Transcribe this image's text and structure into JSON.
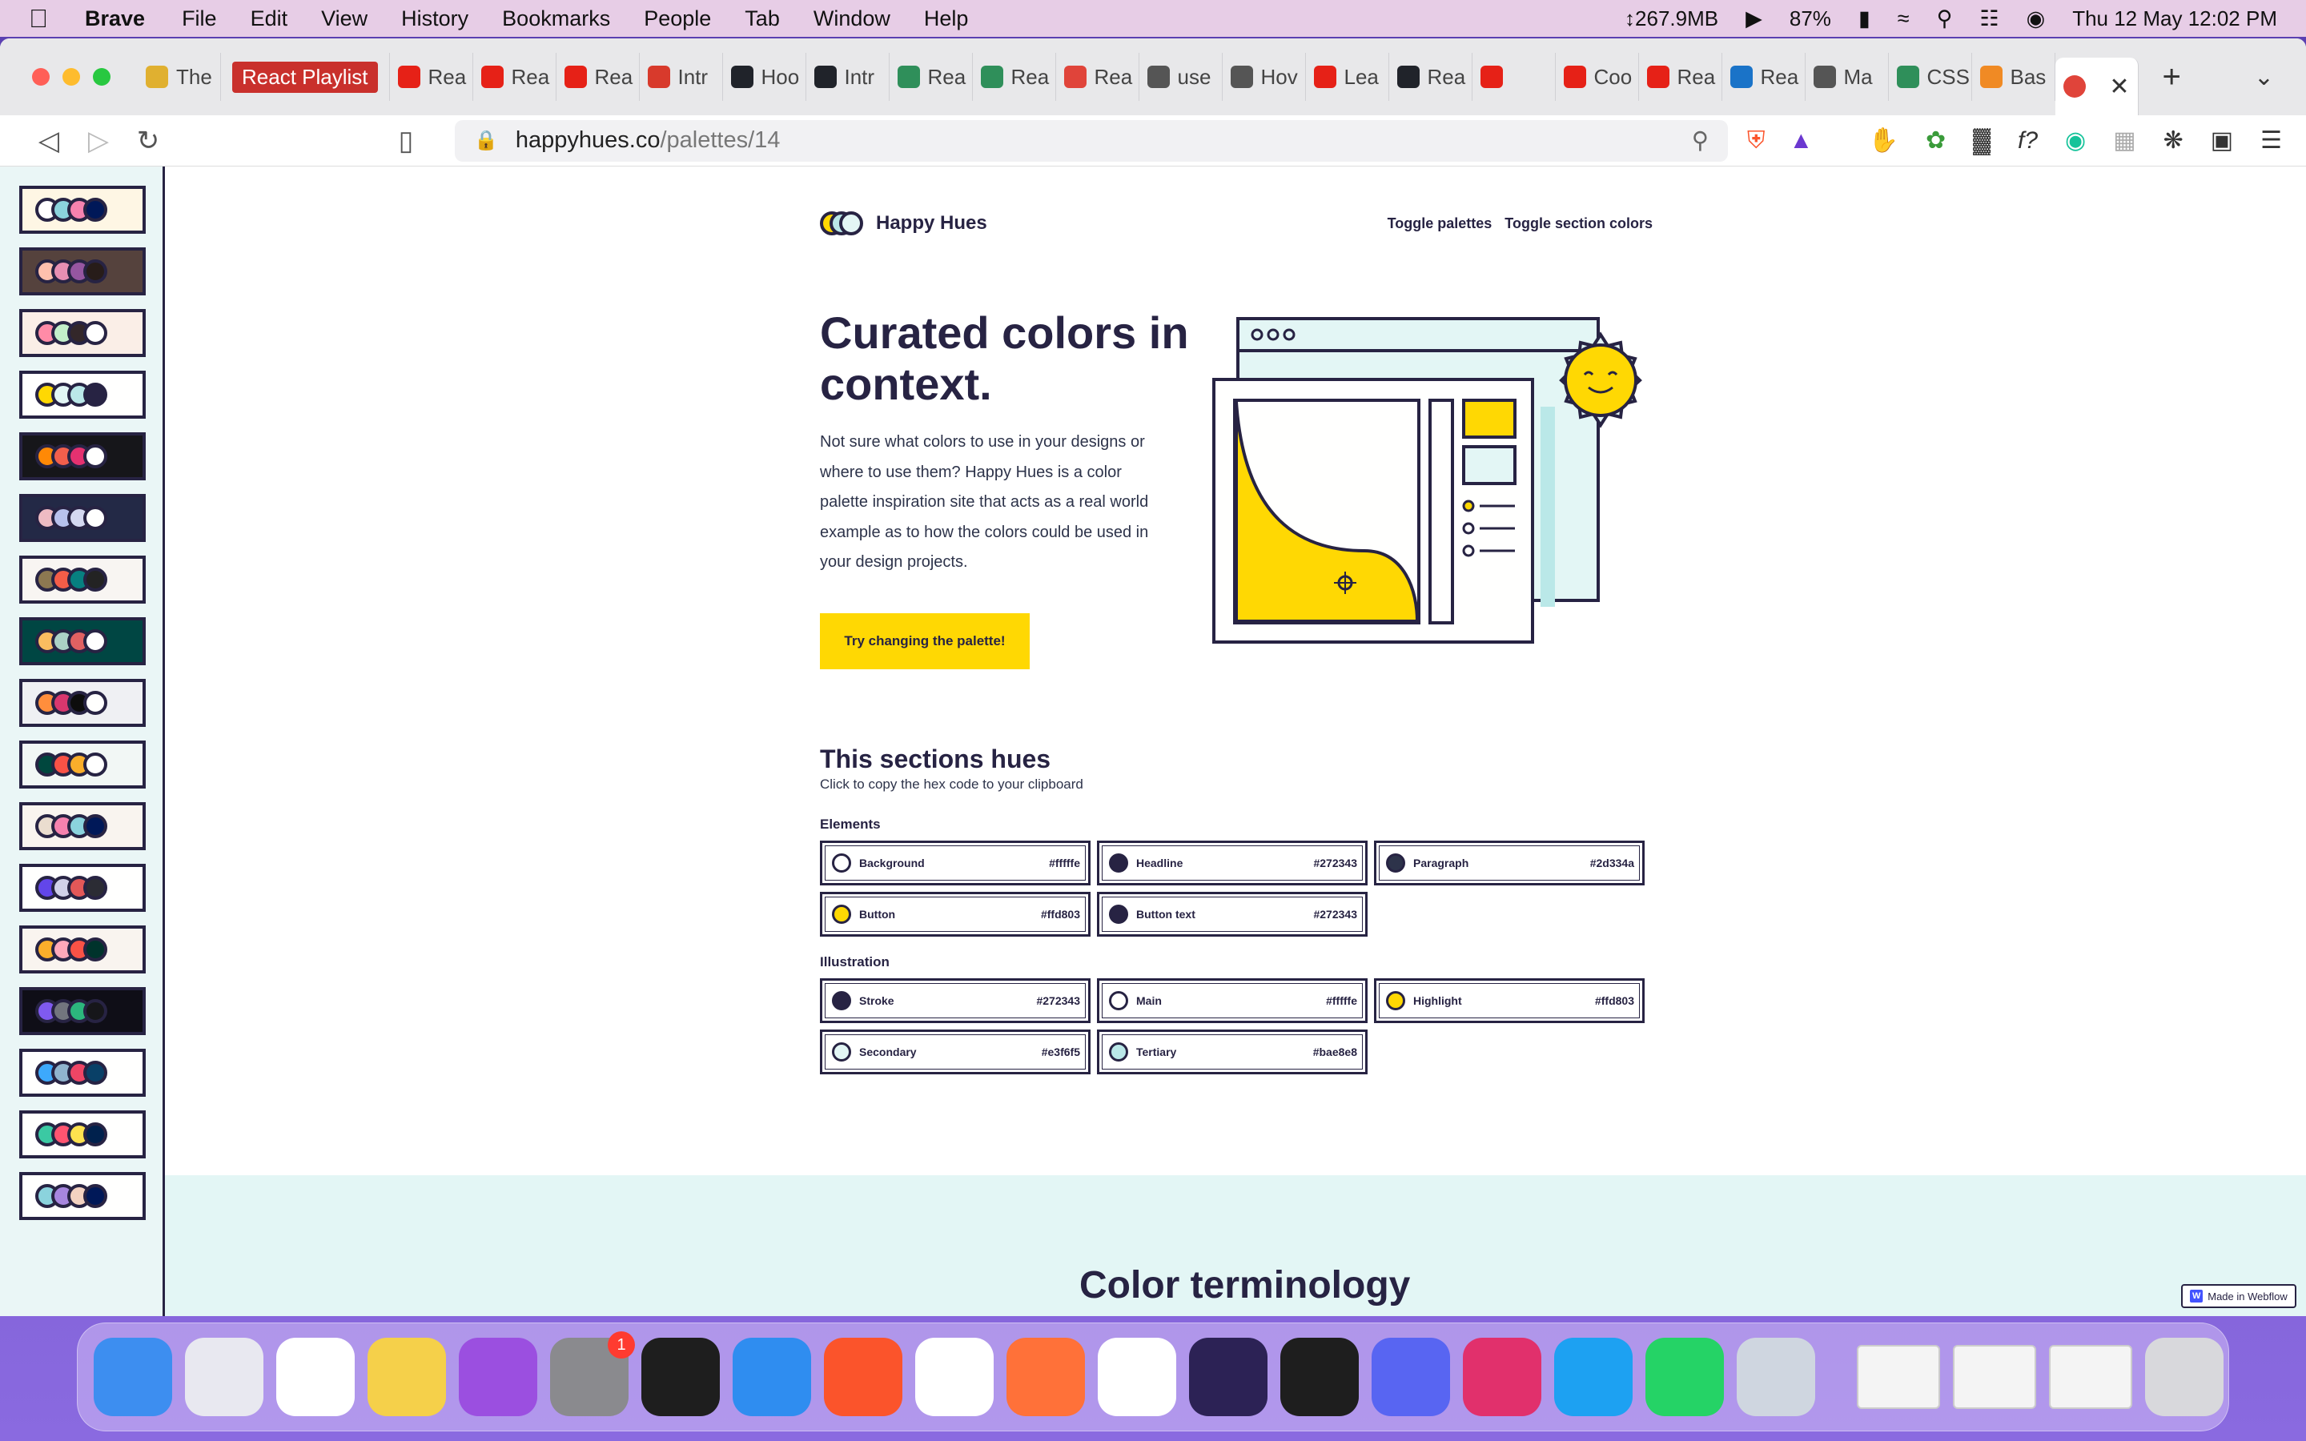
{
  "menubar": {
    "app": "Brave",
    "items": [
      "File",
      "Edit",
      "View",
      "History",
      "Bookmarks",
      "People",
      "Tab",
      "Window",
      "Help"
    ],
    "memory": "↕267.9MB",
    "battery": "87%",
    "datetime": "Thu 12 May  12:02 PM"
  },
  "tabs": {
    "pinned_label": "React Playlist",
    "items": [
      {
        "label": "The",
        "color": "#e0b030"
      },
      {
        "label": "Rea",
        "color": "#e62117"
      },
      {
        "label": "Rea",
        "color": "#e62117"
      },
      {
        "label": "Rea",
        "color": "#e62117"
      },
      {
        "label": "Intr",
        "color": "#d83a2c"
      },
      {
        "label": "Hoo",
        "color": "#20232a"
      },
      {
        "label": "Intr",
        "color": "#20232a"
      },
      {
        "label": "Rea",
        "color": "#2f8f5a"
      },
      {
        "label": "Rea",
        "color": "#2f8f5a"
      },
      {
        "label": "Rea",
        "color": "#e0443a"
      },
      {
        "label": "use",
        "color": "#555555"
      },
      {
        "label": "Hov",
        "color": "#555555"
      },
      {
        "label": "Lea",
        "color": "#e62117"
      },
      {
        "label": "Rea",
        "color": "#20232a"
      },
      {
        "label": "",
        "color": "#e62117"
      },
      {
        "label": "Coo",
        "color": "#e62117"
      },
      {
        "label": "Rea",
        "color": "#e62117"
      },
      {
        "label": "Rea",
        "color": "#1a73c8"
      },
      {
        "label": "Ma",
        "color": "#555555"
      },
      {
        "label": "CSS",
        "color": "#2f8f5a"
      },
      {
        "label": "Bas",
        "color": "#f08a24"
      }
    ],
    "active_close": "✕",
    "new_tab": "+"
  },
  "toolbar": {
    "url_host": "happyhues.co",
    "url_path": "/palettes/14"
  },
  "sidebar": {
    "palettes": [
      {
        "bg": "#fef6e4",
        "dots": [
          "#ffffff",
          "#8bd3dd",
          "#f582ae",
          "#001858"
        ]
      },
      {
        "bg": "#55423d",
        "dots": [
          "#ffc0ad",
          "#e78fb3",
          "#9656a1",
          "#271c19"
        ]
      },
      {
        "bg": "#faeee7",
        "dots": [
          "#ff8ba7",
          "#c3f0ca",
          "#33272a",
          "#ffffff"
        ]
      },
      {
        "bg": "#fffffe",
        "dots": [
          "#ffd803",
          "#e3f6f5",
          "#bae8e8",
          "#272343"
        ]
      },
      {
        "bg": "#16161a",
        "dots": [
          "#ff8906",
          "#f25f4c",
          "#e53170",
          "#fffffe"
        ]
      },
      {
        "bg": "#232946",
        "dots": [
          "#eebbc3",
          "#b8c1ec",
          "#d4d8f0",
          "#fffffe"
        ]
      },
      {
        "bg": "#f8f5f2",
        "dots": [
          "#8c7851",
          "#f45d48",
          "#078080",
          "#232323"
        ]
      },
      {
        "bg": "#004643",
        "dots": [
          "#f9bc60",
          "#abd1c6",
          "#e16162",
          "#fffffe"
        ]
      },
      {
        "bg": "#eff0f3",
        "dots": [
          "#ff8e3c",
          "#d9376e",
          "#0d0d0d",
          "#fffffe"
        ]
      },
      {
        "bg": "#f2f7f5",
        "dots": [
          "#00473e",
          "#fa5246",
          "#faae2b",
          "#ffffff"
        ]
      },
      {
        "bg": "#f9f4ef",
        "dots": [
          "#eaddcf",
          "#f582ae",
          "#8bd3dd",
          "#001858"
        ]
      },
      {
        "bg": "#fffffe",
        "dots": [
          "#6246ea",
          "#d1d1e9",
          "#e45858",
          "#2b2c34"
        ]
      },
      {
        "bg": "#f9f4ef",
        "dots": [
          "#faae2b",
          "#ffa8ba",
          "#fa5246",
          "#00332c"
        ]
      },
      {
        "bg": "#0f0e17",
        "dots": [
          "#7f5af0",
          "#72757e",
          "#2cb67d",
          "#16161a"
        ]
      },
      {
        "bg": "#fffffe",
        "dots": [
          "#3da9fc",
          "#90b4ce",
          "#ef4565",
          "#094067"
        ]
      },
      {
        "bg": "#fffffe",
        "dots": [
          "#3bc9a3",
          "#ff5470",
          "#fde24f",
          "#00214d"
        ]
      },
      {
        "bg": "#fffffe",
        "dots": [
          "#8bd3dd",
          "#a786df",
          "#f3d2c1",
          "#001858"
        ]
      }
    ]
  },
  "site": {
    "brand": "Happy Hues",
    "nav": [
      "Toggle palettes",
      "Toggle section colors"
    ],
    "hero_title": "Curated colors in context.",
    "hero_text": "Not sure what colors to use in your designs or where to use them? Happy Hues is a color palette inspiration site that acts as a real world example as to how the colors could be used in your design projects.",
    "cta": "Try changing the palette!",
    "section_title": "This sections hues",
    "section_sub": "Click to copy the hex code to your clipboard",
    "elements_label": "Elements",
    "elements": [
      {
        "name": "Background",
        "hex": "#fffffe",
        "color": "#fffffe"
      },
      {
        "name": "Headline",
        "hex": "#272343",
        "color": "#272343"
      },
      {
        "name": "Paragraph",
        "hex": "#2d334a",
        "color": "#2d334a"
      },
      {
        "name": "Button",
        "hex": "#ffd803",
        "color": "#ffd803"
      },
      {
        "name": "Button text",
        "hex": "#272343",
        "color": "#272343"
      }
    ],
    "illustration_label": "Illustration",
    "illustration": [
      {
        "name": "Stroke",
        "hex": "#272343",
        "color": "#272343"
      },
      {
        "name": "Main",
        "hex": "#fffffe",
        "color": "#fffffe"
      },
      {
        "name": "Highlight",
        "hex": "#ffd803",
        "color": "#ffd803"
      },
      {
        "name": "Secondary",
        "hex": "#e3f6f5",
        "color": "#e3f6f5"
      },
      {
        "name": "Tertiary",
        "hex": "#bae8e8",
        "color": "#bae8e8"
      }
    ],
    "next_section_title": "Color terminology",
    "webflow_badge": "Made in Webflow"
  },
  "dock": {
    "apps": [
      {
        "name": "finder-icon",
        "color": "#3d8ef0"
      },
      {
        "name": "launchpad-icon",
        "color": "#e8e8f0"
      },
      {
        "name": "reminders-icon",
        "color": "#ffffff"
      },
      {
        "name": "notes-icon",
        "color": "#f5d04a"
      },
      {
        "name": "podcasts-icon",
        "color": "#9b4fe0"
      },
      {
        "name": "system-preferences-icon",
        "color": "#8a8a8e",
        "badge": "1"
      },
      {
        "name": "activity-monitor-icon",
        "color": "#1e1e1e"
      },
      {
        "name": "safari-icon",
        "color": "#2f8df0"
      },
      {
        "name": "brave-icon",
        "color": "#fb542b"
      },
      {
        "name": "chrome-icon",
        "color": "#ffffff"
      },
      {
        "name": "firefox-icon",
        "color": "#ff7139"
      },
      {
        "name": "vscode-icon",
        "color": "#ffffff"
      },
      {
        "name": "eclipse-icon",
        "color": "#2c2255"
      },
      {
        "name": "terminal-icon",
        "color": "#1e1e1e"
      },
      {
        "name": "discord-icon",
        "color": "#5865f2"
      },
      {
        "name": "instagram-icon",
        "color": "#e1306c"
      },
      {
        "name": "twitter-icon",
        "color": "#1da1f2"
      },
      {
        "name": "whatsapp-icon",
        "color": "#25d366"
      },
      {
        "name": "preview-icon",
        "color": "#cfd6e0"
      }
    ]
  }
}
